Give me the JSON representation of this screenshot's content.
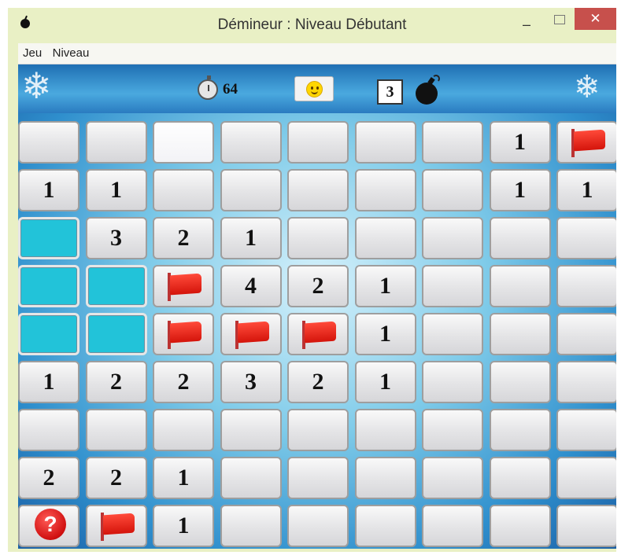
{
  "window": {
    "title": "Démineur : Niveau Débutant",
    "minimize_glyph": "–",
    "close_glyph": "✕"
  },
  "menu": {
    "items": [
      "Jeu",
      "Niveau"
    ]
  },
  "header": {
    "timer_value": "64",
    "mine_count": "3",
    "face_icon": "smiley-face-icon"
  },
  "board": {
    "rows": [
      [
        {
          "s": "u",
          "v": ""
        },
        {
          "s": "u",
          "v": ""
        },
        {
          "s": "l",
          "v": ""
        },
        {
          "s": "u",
          "v": ""
        },
        {
          "s": "u",
          "v": ""
        },
        {
          "s": "u",
          "v": ""
        },
        {
          "s": "u",
          "v": ""
        },
        {
          "s": "n",
          "v": "1"
        },
        {
          "s": "f",
          "v": ""
        }
      ],
      [
        {
          "s": "n",
          "v": "1"
        },
        {
          "s": "n",
          "v": "1"
        },
        {
          "s": "u",
          "v": ""
        },
        {
          "s": "u",
          "v": ""
        },
        {
          "s": "u",
          "v": ""
        },
        {
          "s": "u",
          "v": ""
        },
        {
          "s": "u",
          "v": ""
        },
        {
          "s": "n",
          "v": "1"
        },
        {
          "s": "n",
          "v": "1"
        }
      ],
      [
        {
          "s": "c",
          "v": ""
        },
        {
          "s": "n",
          "v": "3"
        },
        {
          "s": "n",
          "v": "2"
        },
        {
          "s": "n",
          "v": "1"
        },
        {
          "s": "u",
          "v": ""
        },
        {
          "s": "u",
          "v": ""
        },
        {
          "s": "u",
          "v": ""
        },
        {
          "s": "u",
          "v": ""
        },
        {
          "s": "u",
          "v": ""
        }
      ],
      [
        {
          "s": "c",
          "v": ""
        },
        {
          "s": "c",
          "v": ""
        },
        {
          "s": "f",
          "v": ""
        },
        {
          "s": "n",
          "v": "4"
        },
        {
          "s": "n",
          "v": "2"
        },
        {
          "s": "n",
          "v": "1"
        },
        {
          "s": "u",
          "v": ""
        },
        {
          "s": "u",
          "v": ""
        },
        {
          "s": "u",
          "v": ""
        }
      ],
      [
        {
          "s": "c",
          "v": ""
        },
        {
          "s": "c",
          "v": ""
        },
        {
          "s": "f",
          "v": ""
        },
        {
          "s": "f",
          "v": ""
        },
        {
          "s": "f",
          "v": ""
        },
        {
          "s": "n",
          "v": "1"
        },
        {
          "s": "u",
          "v": ""
        },
        {
          "s": "u",
          "v": ""
        },
        {
          "s": "u",
          "v": ""
        }
      ],
      [
        {
          "s": "n",
          "v": "1"
        },
        {
          "s": "n",
          "v": "2"
        },
        {
          "s": "n",
          "v": "2"
        },
        {
          "s": "n",
          "v": "3"
        },
        {
          "s": "n",
          "v": "2"
        },
        {
          "s": "n",
          "v": "1"
        },
        {
          "s": "u",
          "v": ""
        },
        {
          "s": "u",
          "v": ""
        },
        {
          "s": "u",
          "v": ""
        }
      ],
      [
        {
          "s": "u",
          "v": ""
        },
        {
          "s": "u",
          "v": ""
        },
        {
          "s": "u",
          "v": ""
        },
        {
          "s": "u",
          "v": ""
        },
        {
          "s": "u",
          "v": ""
        },
        {
          "s": "u",
          "v": ""
        },
        {
          "s": "u",
          "v": ""
        },
        {
          "s": "u",
          "v": ""
        },
        {
          "s": "u",
          "v": ""
        }
      ],
      [
        {
          "s": "n",
          "v": "2"
        },
        {
          "s": "n",
          "v": "2"
        },
        {
          "s": "n",
          "v": "1"
        },
        {
          "s": "u",
          "v": ""
        },
        {
          "s": "u",
          "v": ""
        },
        {
          "s": "u",
          "v": ""
        },
        {
          "s": "u",
          "v": ""
        },
        {
          "s": "u",
          "v": ""
        },
        {
          "s": "u",
          "v": ""
        }
      ],
      [
        {
          "s": "q",
          "v": "?"
        },
        {
          "s": "f",
          "v": ""
        },
        {
          "s": "n",
          "v": "1"
        },
        {
          "s": "u",
          "v": ""
        },
        {
          "s": "u",
          "v": ""
        },
        {
          "s": "u",
          "v": ""
        },
        {
          "s": "u",
          "v": ""
        },
        {
          "s": "u",
          "v": ""
        },
        {
          "s": "u",
          "v": ""
        }
      ]
    ]
  },
  "colors": {
    "cyan_cell": "#22c3d9",
    "flag_red": "#e0241a",
    "titlebar": "#e9f0c5",
    "close_button": "#c7504c"
  }
}
